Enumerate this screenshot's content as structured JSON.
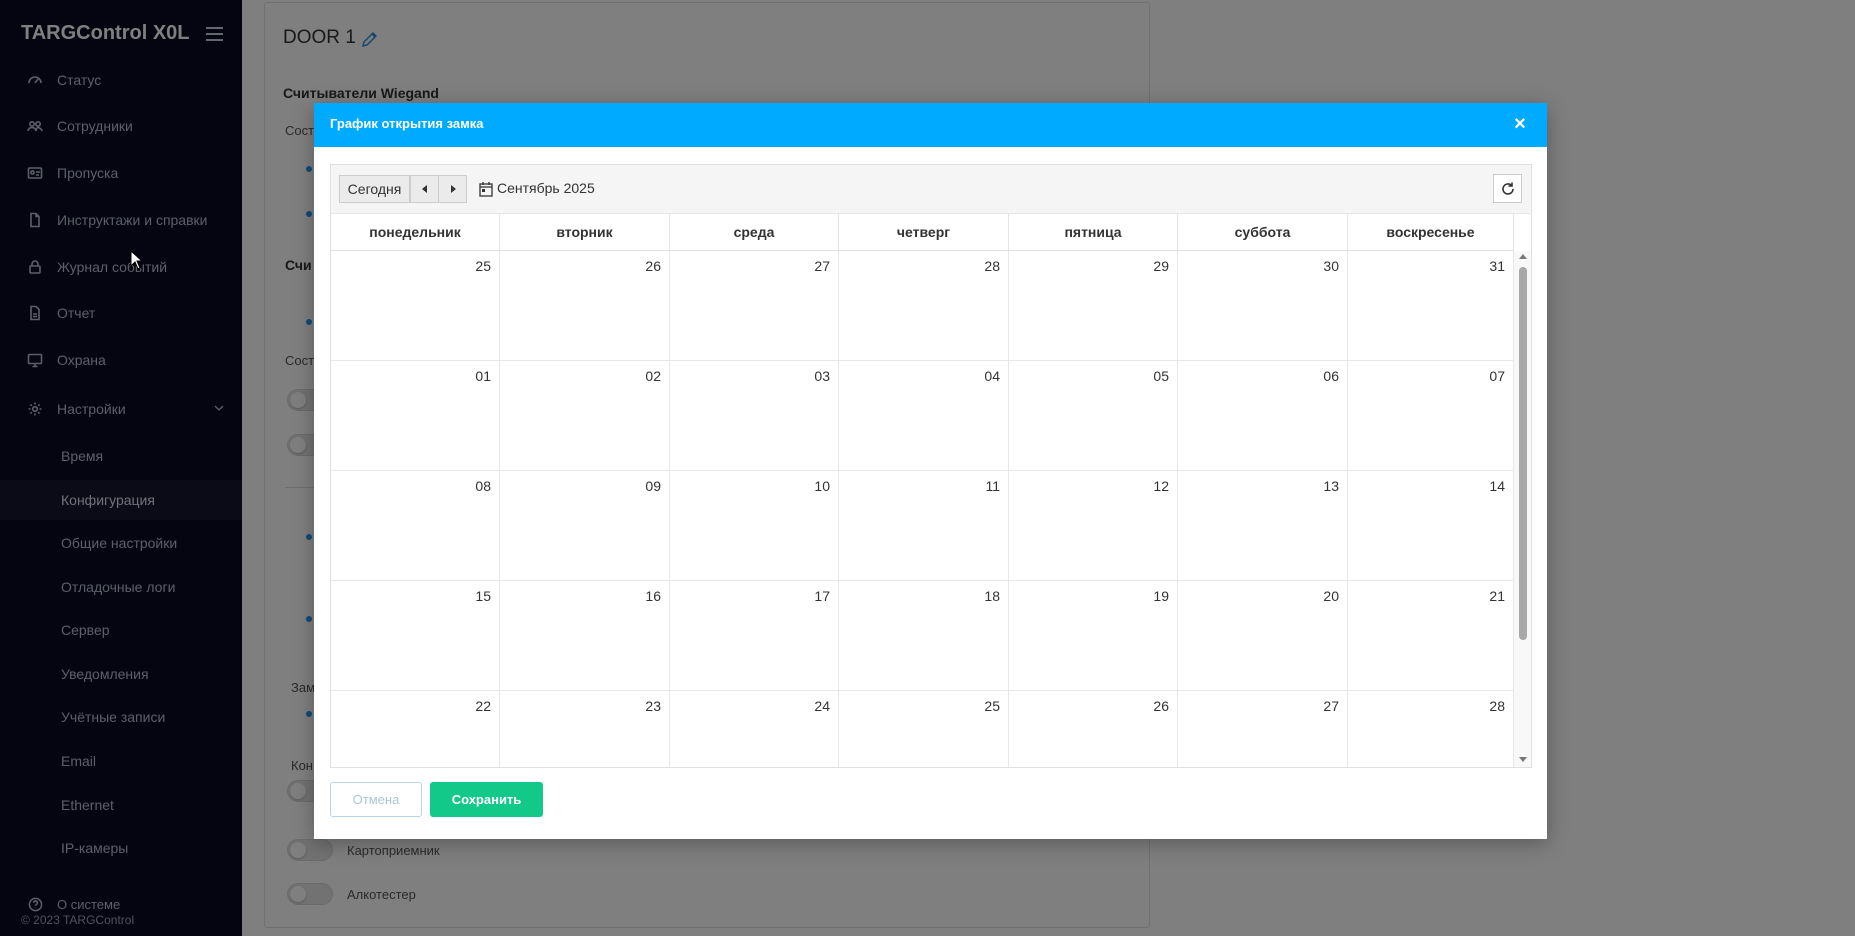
{
  "app": {
    "title": "TARGControl X0L",
    "copyright": "© 2023 TARGControl"
  },
  "sidebar": {
    "items": [
      {
        "label": "Статус",
        "icon": "gauge-icon"
      },
      {
        "label": "Сотрудники",
        "icon": "users-icon"
      },
      {
        "label": "Пропуска",
        "icon": "id-card-icon"
      },
      {
        "label": "Инструктажи и справки",
        "icon": "document-icon"
      },
      {
        "label": "Журнал событий",
        "icon": "lock-icon"
      },
      {
        "label": "Отчет",
        "icon": "report-icon"
      },
      {
        "label": "Охрана",
        "icon": "monitor-icon"
      },
      {
        "label": "Настройки",
        "icon": "gear-icon"
      }
    ],
    "subitems": [
      "Время",
      "Конфигурация",
      "Общие настройки",
      "Отладочные логи",
      "Сервер",
      "Уведомления",
      "Учётные записи",
      "Email",
      "Ethernet",
      "IP-камеры"
    ],
    "active_subitem": "Конфигурация",
    "about": "О системе"
  },
  "background": {
    "door_title": "DOOR 1",
    "section_wiegand": "Считыватели Wiegand",
    "label_sost1": "Сост",
    "label_sch": "Счи",
    "label_sost2": "Сост",
    "label_zam": "Зам",
    "label_kon": "Кон",
    "toggle_card": "Картоприемник",
    "toggle_alco": "Алкотестер"
  },
  "modal": {
    "title": "График открытия замка",
    "close": "×",
    "today_button": "Сегодня",
    "month_label": "Сентябрь 2025",
    "weekdays": [
      "понедельник",
      "вторник",
      "среда",
      "четверг",
      "пятница",
      "суббота",
      "воскресенье"
    ],
    "weeks": [
      [
        "25",
        "26",
        "27",
        "28",
        "29",
        "30",
        "31"
      ],
      [
        "01",
        "02",
        "03",
        "04",
        "05",
        "06",
        "07"
      ],
      [
        "08",
        "09",
        "10",
        "11",
        "12",
        "13",
        "14"
      ],
      [
        "15",
        "16",
        "17",
        "18",
        "19",
        "20",
        "21"
      ],
      [
        "22",
        "23",
        "24",
        "25",
        "26",
        "27",
        "28"
      ]
    ],
    "cancel_button": "Отмена",
    "save_button": "Сохранить"
  },
  "colors": {
    "header": "#00aaff",
    "save": "#12c98a",
    "sidebar": "#0a0a24"
  }
}
